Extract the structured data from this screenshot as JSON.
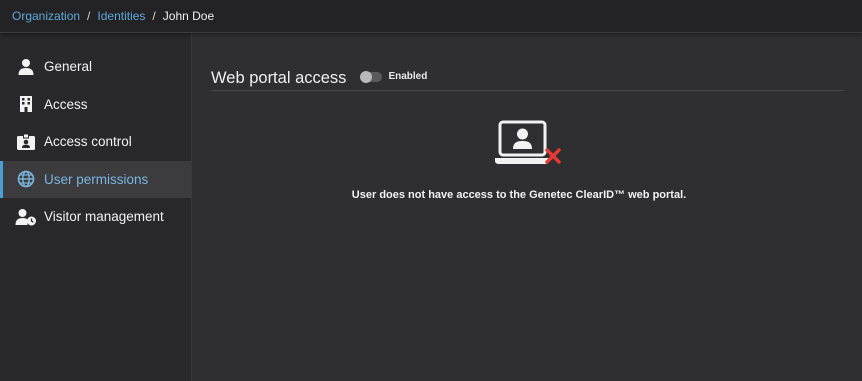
{
  "breadcrumb": {
    "items": [
      {
        "label": "Organization"
      },
      {
        "label": "Identities"
      },
      {
        "label": "John Doe"
      }
    ],
    "separator": "/"
  },
  "sidebar": {
    "items": [
      {
        "label": "General",
        "icon": "person-icon"
      },
      {
        "label": "Access",
        "icon": "building-icon"
      },
      {
        "label": "Access control",
        "icon": "id-badge-icon"
      },
      {
        "label": "User permissions",
        "icon": "globe-icon",
        "active": true
      },
      {
        "label": "Visitor management",
        "icon": "visitor-clock-icon"
      }
    ]
  },
  "main": {
    "section_title": "Web portal access",
    "toggle": {
      "label": "Enabled",
      "on": false
    },
    "empty_state": {
      "icon": "laptop-user-blocked-icon",
      "message": "User does not have access to the Genetec ClearID™ web portal."
    }
  },
  "colors": {
    "link": "#5fa8d8",
    "active_accent": "#4a9fd4",
    "error_x": "#e53935",
    "background": "#2f2f31",
    "sidebar_bg": "#29292b"
  }
}
